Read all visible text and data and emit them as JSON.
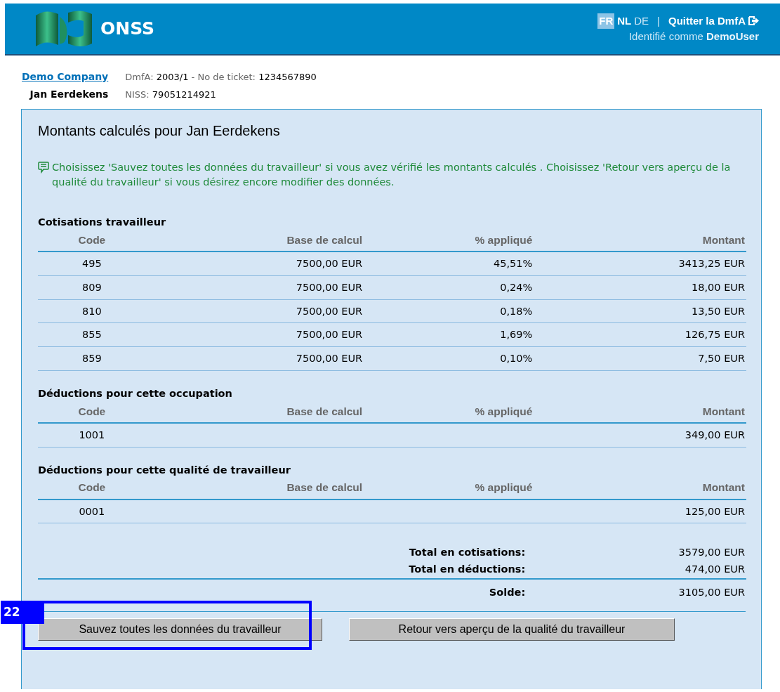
{
  "header": {
    "brand": "ONSS",
    "languages": [
      {
        "code": "FR",
        "selected": true
      },
      {
        "code": "NL",
        "selected": false
      },
      {
        "code": "DE",
        "selected": false
      }
    ],
    "separator": "|",
    "logout": "Quitter la DmfA",
    "identified_prefix": "Identifié comme",
    "user": "DemoUser"
  },
  "info": {
    "company": "Demo Company",
    "worker": "Jan Eerdekens",
    "dmfa_label": "DmfA:",
    "dmfa_value": "2003/1",
    "ticket_label": "- No de ticket:",
    "ticket_value": "1234567890",
    "niss_label": "NISS:",
    "niss_value": "79051214921"
  },
  "panel": {
    "title": "Montants calculés pour Jan Eerdekens",
    "message": "Choisissez 'Sauvez toutes les données du travailleur' si vous avez vérifié les montants calculés . Choisissez 'Retour vers aperçu de la qualité du travailleur' si vous désirez encore modifier des données."
  },
  "sections": [
    {
      "title": "Cotisations travailleur",
      "columns": [
        "Code",
        "Base de calcul",
        "% appliqué",
        "Montant"
      ],
      "rows": [
        [
          "495",
          "7500,00 EUR",
          "45,51%",
          "3413,25 EUR"
        ],
        [
          "809",
          "7500,00 EUR",
          "0,24%",
          "18,00 EUR"
        ],
        [
          "810",
          "7500,00 EUR",
          "0,18%",
          "13,50 EUR"
        ],
        [
          "855",
          "7500,00 EUR",
          "1,69%",
          "126,75 EUR"
        ],
        [
          "859",
          "7500,00 EUR",
          "0,10%",
          "7,50 EUR"
        ]
      ]
    },
    {
      "title": "Déductions pour cette occupation",
      "columns": [
        "Code",
        "Base de calcul",
        "% appliqué",
        "Montant"
      ],
      "rows": [
        [
          "1001",
          "",
          "",
          "349,00 EUR"
        ]
      ]
    },
    {
      "title": "Déductions pour cette qualité de travailleur",
      "columns": [
        "Code",
        "Base de calcul",
        "% appliqué",
        "Montant"
      ],
      "rows": [
        [
          "0001",
          "",
          "",
          "125,00 EUR"
        ]
      ]
    }
  ],
  "totals": [
    {
      "label": "Total en cotisations:",
      "value": "3579,00 EUR"
    },
    {
      "label": "Total en déductions:",
      "value": "474,00 EUR"
    },
    {
      "label": "Solde:",
      "value": "3105,00 EUR"
    }
  ],
  "buttons": [
    "Sauvez toutes les données du travailleur",
    "Retour vers aperçu de la qualité du travailleur"
  ],
  "annotation": {
    "label": "22"
  }
}
